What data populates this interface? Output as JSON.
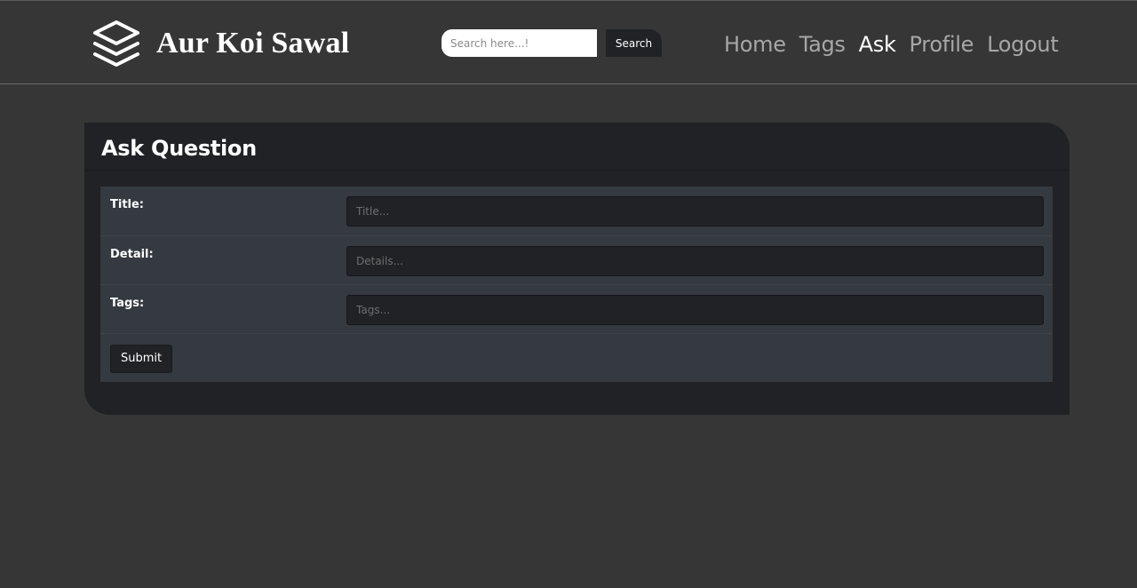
{
  "brand": {
    "name": "Aur Koi Sawal",
    "icon": "layers-icon"
  },
  "search": {
    "placeholder": "Search here...!",
    "value": "",
    "button_label": "Search"
  },
  "nav": {
    "items": [
      {
        "label": "Home",
        "active": false
      },
      {
        "label": "Tags",
        "active": false
      },
      {
        "label": "Ask",
        "active": true
      },
      {
        "label": "Profile",
        "active": false
      },
      {
        "label": "Logout",
        "active": false
      }
    ]
  },
  "form": {
    "heading": "Ask Question",
    "fields": [
      {
        "label": "Title:",
        "placeholder": "Title...",
        "value": ""
      },
      {
        "label": "Detail:",
        "placeholder": "Details...",
        "value": ""
      },
      {
        "label": "Tags:",
        "placeholder": "Tags...",
        "value": ""
      }
    ],
    "submit_label": "Submit"
  },
  "colors": {
    "page_background": "#363636",
    "card_background": "#212226",
    "table_background": "#343a40",
    "nav_active": "#ffffff",
    "nav_inactive": "#a7a7a7"
  }
}
